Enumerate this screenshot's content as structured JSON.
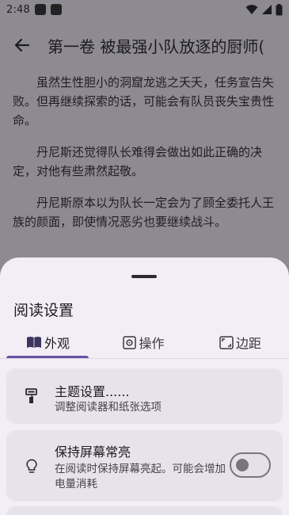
{
  "status_bar": {
    "time": "2:48"
  },
  "app_bar": {
    "title": "第一卷 被最强小队放逐的厨师("
  },
  "reader": {
    "paragraphs": [
      "虽然生性胆小的洞窟龙逃之夭夭，任务宣告失败。但再继续探索的话，可能会有队员丧失宝贵性命。",
      "丹尼斯还觉得队长难得会做出如此正确的决定，对他有些肃然起敬。",
      "丹尼斯原本以为队长一定会为了顾全委托人王族的颜面，即使情况恶劣也要继续战斗。"
    ]
  },
  "sheet": {
    "title": "阅读设置",
    "tabs": [
      {
        "label": "外观",
        "icon": "book-open-icon",
        "active": true
      },
      {
        "label": "操作",
        "icon": "gear-square-icon",
        "active": false
      },
      {
        "label": "边距",
        "icon": "margin-frame-icon",
        "active": false
      }
    ],
    "items": [
      {
        "title": "主题设置......",
        "subtitle": "调整阅读器和纸张选项",
        "icon": "paint-roller-icon"
      },
      {
        "title": "保持屏幕常亮",
        "subtitle": "在阅读时保持屏幕亮起。可能会增加电量消耗",
        "icon": "lightbulb-icon",
        "toggle": false
      }
    ]
  },
  "colors": {
    "accent": "#6750a4",
    "sheet_bg": "#f3eef6",
    "card_bg": "#e8e2ea",
    "scrim": "#8d8a91"
  }
}
